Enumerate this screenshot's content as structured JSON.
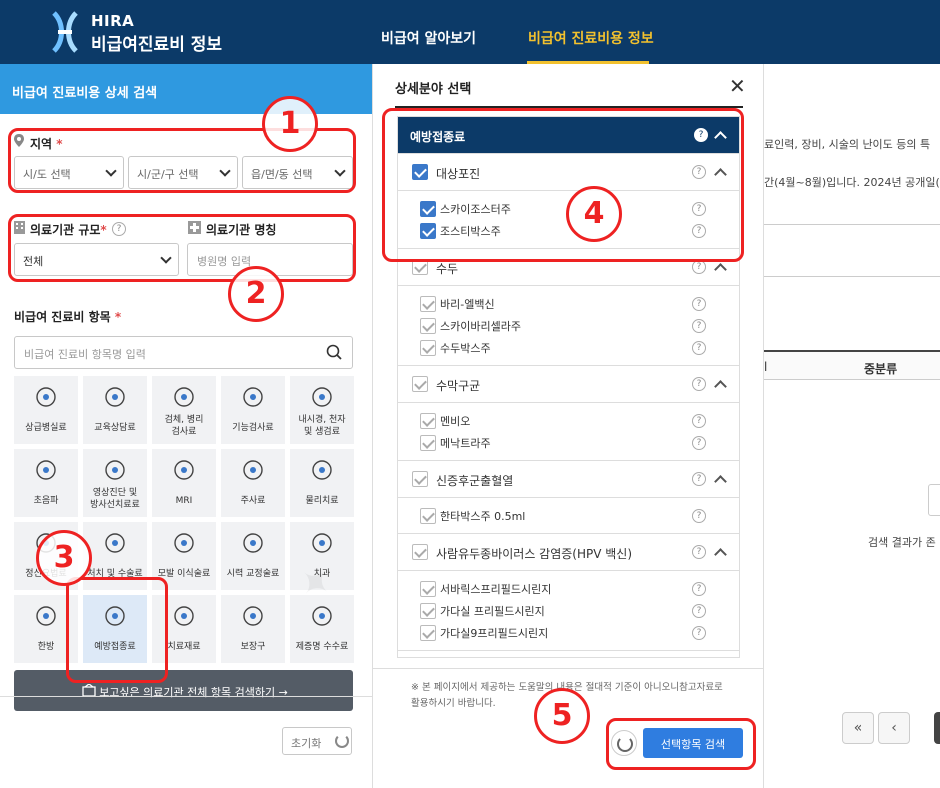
{
  "header": {
    "brand_top": "HIRA",
    "brand_sub": "비급여진료비 정보",
    "nav": [
      "비급여 알아보기",
      "비급여 진료비용 정보"
    ]
  },
  "left": {
    "title": "비급여 진료비용 상세 검색",
    "region_label": "지역",
    "region_req": "*",
    "selects": [
      "시/도 선택",
      "시/군/구 선택",
      "읍/면/동 선택"
    ],
    "scale_label": "의료기관 규모",
    "scale_req": "*",
    "scale_value": "전체",
    "name_label": "의료기관 명칭",
    "name_placeholder": "병원명 입력",
    "item_label": "비급여 진료비 항목",
    "item_req": "*",
    "item_placeholder": "비급여 진료비 항목명 입력",
    "categories": [
      [
        "상급병실료"
      ],
      [
        "교육상담료"
      ],
      [
        "검체, 병리",
        "검사료"
      ],
      [
        "기능검사료"
      ],
      [
        "내시경, 천자",
        "및 생검료"
      ],
      [
        "초음파"
      ],
      [
        "영상진단 및",
        "방사선치료료"
      ],
      [
        "MRI"
      ],
      [
        "주사료"
      ],
      [
        "물리치료"
      ],
      [
        "정신요법료"
      ],
      [
        "처치 및 수술료"
      ],
      [
        "모발 이식술료"
      ],
      [
        "시력 교정술료"
      ],
      [
        "치과"
      ],
      [
        "한방"
      ],
      [
        "예방접종료"
      ],
      [
        "치료재료"
      ],
      [
        "보장구"
      ],
      [
        "제증명 수수료"
      ]
    ],
    "search_all": "보고싶은 의료기관 전체 항목 검색하기  →",
    "reset": "초기화"
  },
  "modal": {
    "title": "상세분야 선택",
    "close": "✕",
    "head_group": "예방접종료",
    "groups": [
      {
        "label": "대상포진",
        "items": [
          "스카이조스터주",
          "조스티박스주"
        ]
      },
      {
        "label": "수두",
        "items": [
          "바리-엘백신",
          "스카이바리셀라주",
          "수두박스주"
        ]
      },
      {
        "label": "수막구균",
        "items": [
          "멘비오",
          "메낙트라주"
        ]
      },
      {
        "label": "신증후군출혈열",
        "items": [
          "한타박스주 0.5ml"
        ]
      },
      {
        "label": "사람유두종바이러스 감염증(HPV 백신)",
        "items": [
          "서바릭스프리필드시린지",
          "가다실 프리필드시린지",
          "가다실9프리필드시린지"
        ]
      }
    ],
    "note": "※ 본 페이지에서 제공하는 도움말의 내용은 절대적 기준이 아니오니참고자료로 활용하시기 바랍니다.",
    "select_button": "선택항목 검색"
  },
  "right": {
    "text1": "료인력, 장비, 시술의 난이도 등의 특",
    "text2": "간(4월~8월)입니다. 2024년 공개일(",
    "col1": "l",
    "col2": "중분류",
    "empty": "검색 결과가 존",
    "pg_first": "«",
    "pg_prev": "‹"
  },
  "annotations": [
    "1",
    "2",
    "3",
    "4",
    "5"
  ],
  "colors": {
    "navy": "#0c3a68",
    "accent": "#f2c12e",
    "blue": "#2f99e0",
    "button": "#2f7de0",
    "annotation": "#e22222"
  }
}
